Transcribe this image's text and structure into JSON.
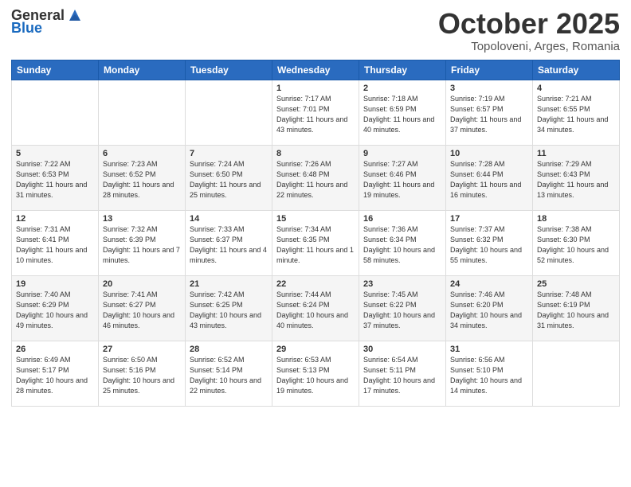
{
  "header": {
    "logo_general": "General",
    "logo_blue": "Blue",
    "month": "October 2025",
    "location": "Topoloveni, Arges, Romania"
  },
  "days_of_week": [
    "Sunday",
    "Monday",
    "Tuesday",
    "Wednesday",
    "Thursday",
    "Friday",
    "Saturday"
  ],
  "weeks": [
    [
      {
        "day": "",
        "sunrise": "",
        "sunset": "",
        "daylight": ""
      },
      {
        "day": "",
        "sunrise": "",
        "sunset": "",
        "daylight": ""
      },
      {
        "day": "",
        "sunrise": "",
        "sunset": "",
        "daylight": ""
      },
      {
        "day": "1",
        "sunrise": "Sunrise: 7:17 AM",
        "sunset": "Sunset: 7:01 PM",
        "daylight": "Daylight: 11 hours and 43 minutes."
      },
      {
        "day": "2",
        "sunrise": "Sunrise: 7:18 AM",
        "sunset": "Sunset: 6:59 PM",
        "daylight": "Daylight: 11 hours and 40 minutes."
      },
      {
        "day": "3",
        "sunrise": "Sunrise: 7:19 AM",
        "sunset": "Sunset: 6:57 PM",
        "daylight": "Daylight: 11 hours and 37 minutes."
      },
      {
        "day": "4",
        "sunrise": "Sunrise: 7:21 AM",
        "sunset": "Sunset: 6:55 PM",
        "daylight": "Daylight: 11 hours and 34 minutes."
      }
    ],
    [
      {
        "day": "5",
        "sunrise": "Sunrise: 7:22 AM",
        "sunset": "Sunset: 6:53 PM",
        "daylight": "Daylight: 11 hours and 31 minutes."
      },
      {
        "day": "6",
        "sunrise": "Sunrise: 7:23 AM",
        "sunset": "Sunset: 6:52 PM",
        "daylight": "Daylight: 11 hours and 28 minutes."
      },
      {
        "day": "7",
        "sunrise": "Sunrise: 7:24 AM",
        "sunset": "Sunset: 6:50 PM",
        "daylight": "Daylight: 11 hours and 25 minutes."
      },
      {
        "day": "8",
        "sunrise": "Sunrise: 7:26 AM",
        "sunset": "Sunset: 6:48 PM",
        "daylight": "Daylight: 11 hours and 22 minutes."
      },
      {
        "day": "9",
        "sunrise": "Sunrise: 7:27 AM",
        "sunset": "Sunset: 6:46 PM",
        "daylight": "Daylight: 11 hours and 19 minutes."
      },
      {
        "day": "10",
        "sunrise": "Sunrise: 7:28 AM",
        "sunset": "Sunset: 6:44 PM",
        "daylight": "Daylight: 11 hours and 16 minutes."
      },
      {
        "day": "11",
        "sunrise": "Sunrise: 7:29 AM",
        "sunset": "Sunset: 6:43 PM",
        "daylight": "Daylight: 11 hours and 13 minutes."
      }
    ],
    [
      {
        "day": "12",
        "sunrise": "Sunrise: 7:31 AM",
        "sunset": "Sunset: 6:41 PM",
        "daylight": "Daylight: 11 hours and 10 minutes."
      },
      {
        "day": "13",
        "sunrise": "Sunrise: 7:32 AM",
        "sunset": "Sunset: 6:39 PM",
        "daylight": "Daylight: 11 hours and 7 minutes."
      },
      {
        "day": "14",
        "sunrise": "Sunrise: 7:33 AM",
        "sunset": "Sunset: 6:37 PM",
        "daylight": "Daylight: 11 hours and 4 minutes."
      },
      {
        "day": "15",
        "sunrise": "Sunrise: 7:34 AM",
        "sunset": "Sunset: 6:35 PM",
        "daylight": "Daylight: 11 hours and 1 minute."
      },
      {
        "day": "16",
        "sunrise": "Sunrise: 7:36 AM",
        "sunset": "Sunset: 6:34 PM",
        "daylight": "Daylight: 10 hours and 58 minutes."
      },
      {
        "day": "17",
        "sunrise": "Sunrise: 7:37 AM",
        "sunset": "Sunset: 6:32 PM",
        "daylight": "Daylight: 10 hours and 55 minutes."
      },
      {
        "day": "18",
        "sunrise": "Sunrise: 7:38 AM",
        "sunset": "Sunset: 6:30 PM",
        "daylight": "Daylight: 10 hours and 52 minutes."
      }
    ],
    [
      {
        "day": "19",
        "sunrise": "Sunrise: 7:40 AM",
        "sunset": "Sunset: 6:29 PM",
        "daylight": "Daylight: 10 hours and 49 minutes."
      },
      {
        "day": "20",
        "sunrise": "Sunrise: 7:41 AM",
        "sunset": "Sunset: 6:27 PM",
        "daylight": "Daylight: 10 hours and 46 minutes."
      },
      {
        "day": "21",
        "sunrise": "Sunrise: 7:42 AM",
        "sunset": "Sunset: 6:25 PM",
        "daylight": "Daylight: 10 hours and 43 minutes."
      },
      {
        "day": "22",
        "sunrise": "Sunrise: 7:44 AM",
        "sunset": "Sunset: 6:24 PM",
        "daylight": "Daylight: 10 hours and 40 minutes."
      },
      {
        "day": "23",
        "sunrise": "Sunrise: 7:45 AM",
        "sunset": "Sunset: 6:22 PM",
        "daylight": "Daylight: 10 hours and 37 minutes."
      },
      {
        "day": "24",
        "sunrise": "Sunrise: 7:46 AM",
        "sunset": "Sunset: 6:20 PM",
        "daylight": "Daylight: 10 hours and 34 minutes."
      },
      {
        "day": "25",
        "sunrise": "Sunrise: 7:48 AM",
        "sunset": "Sunset: 6:19 PM",
        "daylight": "Daylight: 10 hours and 31 minutes."
      }
    ],
    [
      {
        "day": "26",
        "sunrise": "Sunrise: 6:49 AM",
        "sunset": "Sunset: 5:17 PM",
        "daylight": "Daylight: 10 hours and 28 minutes."
      },
      {
        "day": "27",
        "sunrise": "Sunrise: 6:50 AM",
        "sunset": "Sunset: 5:16 PM",
        "daylight": "Daylight: 10 hours and 25 minutes."
      },
      {
        "day": "28",
        "sunrise": "Sunrise: 6:52 AM",
        "sunset": "Sunset: 5:14 PM",
        "daylight": "Daylight: 10 hours and 22 minutes."
      },
      {
        "day": "29",
        "sunrise": "Sunrise: 6:53 AM",
        "sunset": "Sunset: 5:13 PM",
        "daylight": "Daylight: 10 hours and 19 minutes."
      },
      {
        "day": "30",
        "sunrise": "Sunrise: 6:54 AM",
        "sunset": "Sunset: 5:11 PM",
        "daylight": "Daylight: 10 hours and 17 minutes."
      },
      {
        "day": "31",
        "sunrise": "Sunrise: 6:56 AM",
        "sunset": "Sunset: 5:10 PM",
        "daylight": "Daylight: 10 hours and 14 minutes."
      },
      {
        "day": "",
        "sunrise": "",
        "sunset": "",
        "daylight": ""
      }
    ]
  ]
}
